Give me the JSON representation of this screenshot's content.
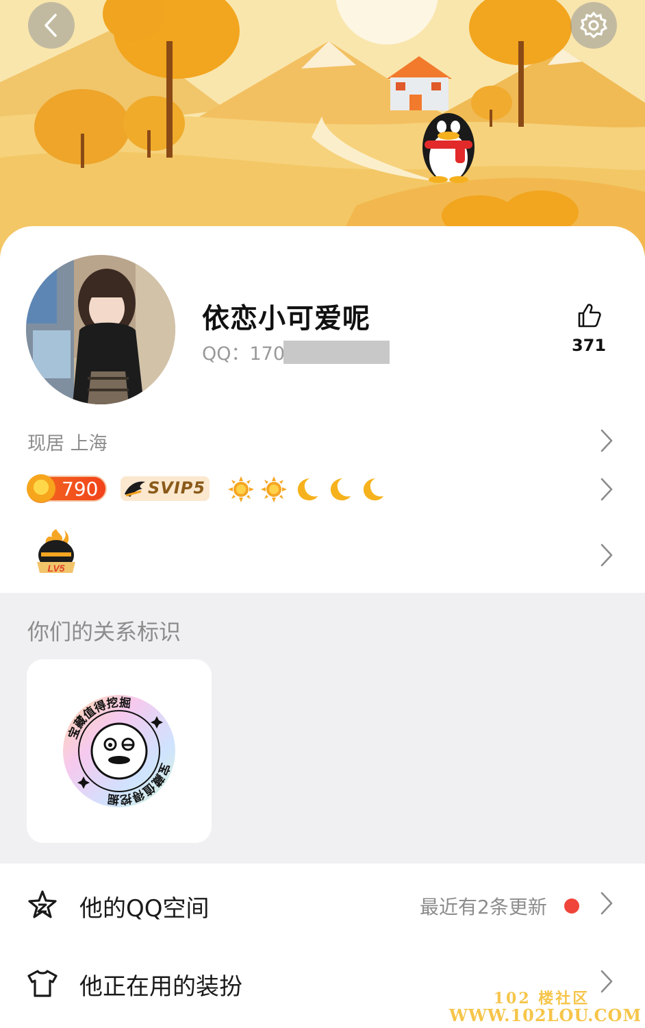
{
  "header": {
    "back_icon": "chevron-left-icon",
    "settings_icon": "gear-icon"
  },
  "profile": {
    "nickname": "依恋小可爱呢",
    "qq_label": "QQ：170",
    "likes": "371",
    "like_icon": "thumbs-up-icon"
  },
  "location": {
    "text": "现居 上海"
  },
  "badges": {
    "coin_value": "790",
    "svip_label": "SVIP5",
    "level_icons": [
      "sun-icon",
      "sun-icon",
      "moon-icon",
      "moon-icon",
      "moon-icon"
    ]
  },
  "level_badge": {
    "icon": "qq-penguin-lv5-icon",
    "text": "LV5"
  },
  "relation": {
    "title": "你们的关系标识",
    "badge_text": "宝藏值得挖掘"
  },
  "list": {
    "qzone_label": "他的QQ空间",
    "qzone_extra": "最近有2条更新",
    "outfit_label": "他正在用的装扮"
  },
  "watermark": {
    "line1": "102 楼社区",
    "line2": "WWW.102LOU.COM"
  },
  "colors": {
    "accent_red": "#f0453a",
    "banner_sky": "#f9e3a3",
    "autumn_orange": "#f3a21c"
  }
}
